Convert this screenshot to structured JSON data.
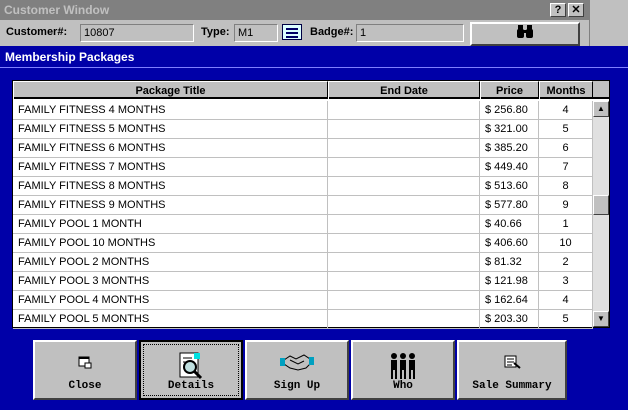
{
  "customer_window": {
    "title": "Customer Window",
    "help_button": "?",
    "close_button": "✕",
    "customer_label": "Customer#:",
    "customer_value": "10807",
    "type_label": "Type:",
    "type_value": "M1",
    "badge_label": "Badge#:",
    "badge_value": "1",
    "search_icon": "binoculars-icon"
  },
  "dialog": {
    "title": "Membership Packages"
  },
  "table": {
    "columns": [
      "Package Title",
      "End Date",
      "Price",
      "Months"
    ],
    "rows": [
      {
        "title": "FAMILY FITNESS 4 MONTHS",
        "end_date": "",
        "price": "$ 256.80",
        "months": "4"
      },
      {
        "title": "FAMILY FITNESS 5 MONTHS",
        "end_date": "",
        "price": "$ 321.00",
        "months": "5"
      },
      {
        "title": "FAMILY FITNESS 6 MONTHS",
        "end_date": "",
        "price": "$ 385.20",
        "months": "6"
      },
      {
        "title": "FAMILY FITNESS 7 MONTHS",
        "end_date": "",
        "price": "$ 449.40",
        "months": "7"
      },
      {
        "title": "FAMILY FITNESS 8 MONTHS",
        "end_date": "",
        "price": "$ 513.60",
        "months": "8"
      },
      {
        "title": "FAMILY FITNESS 9 MONTHS",
        "end_date": "",
        "price": "$ 577.80",
        "months": "9"
      },
      {
        "title": "FAMILY POOL 1 MONTH",
        "end_date": "",
        "price": "$ 40.66",
        "months": "1"
      },
      {
        "title": "FAMILY POOL 10 MONTHS",
        "end_date": "",
        "price": "$ 406.60",
        "months": "10"
      },
      {
        "title": "FAMILY POOL 2 MONTHS",
        "end_date": "",
        "price": "$ 81.32",
        "months": "2"
      },
      {
        "title": "FAMILY POOL 3 MONTHS",
        "end_date": "",
        "price": "$ 121.98",
        "months": "3"
      },
      {
        "title": "FAMILY POOL 4 MONTHS",
        "end_date": "",
        "price": "$ 162.64",
        "months": "4"
      },
      {
        "title": "FAMILY POOL 5 MONTHS",
        "end_date": "",
        "price": "$ 203.30",
        "months": "5"
      }
    ]
  },
  "toolbar": {
    "buttons": [
      {
        "label": "Close",
        "icon": "close-icon"
      },
      {
        "label": "Details",
        "icon": "magnifier-icon"
      },
      {
        "label": "Sign Up",
        "icon": "handshake-icon"
      },
      {
        "label": "Who",
        "icon": "people-icon"
      },
      {
        "label": "Sale Summary",
        "icon": "summary-icon"
      }
    ]
  },
  "colors": {
    "dialog_background": "#0000a8",
    "window_gray": "#c0c0c0",
    "inactive_title": "#808080"
  }
}
